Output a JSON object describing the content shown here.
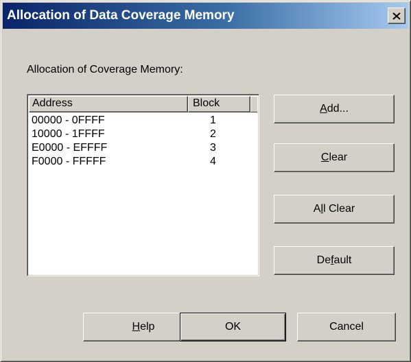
{
  "window": {
    "title": "Allocation of Data Coverage Memory"
  },
  "group": {
    "label": "Allocation of Coverage Memory:"
  },
  "list": {
    "columns": [
      "Address",
      "Block"
    ],
    "rows": [
      {
        "address": "00000 - 0FFFF",
        "block": "1"
      },
      {
        "address": "10000 - 1FFFF",
        "block": "2"
      },
      {
        "address": "E0000 - EFFFF",
        "block": "3"
      },
      {
        "address": "F0000 - FFFFF",
        "block": "4"
      }
    ]
  },
  "buttons": {
    "add": {
      "pre": "",
      "key": "A",
      "post": "dd..."
    },
    "clear": {
      "pre": "",
      "key": "C",
      "post": "lear"
    },
    "all_clear": {
      "pre": "A",
      "key": "l",
      "post": "l Clear"
    },
    "default": {
      "pre": "De",
      "key": "f",
      "post": "ault"
    },
    "help": {
      "pre": "",
      "key": "H",
      "post": "elp"
    },
    "ok": "OK",
    "cancel": "Cancel"
  },
  "icons": {
    "close": "close-icon"
  },
  "colors": {
    "dialog_face": "#d4d0c8",
    "titlebar_start": "#0a246a",
    "titlebar_end": "#a6caf0",
    "title_text": "#ffffff"
  }
}
